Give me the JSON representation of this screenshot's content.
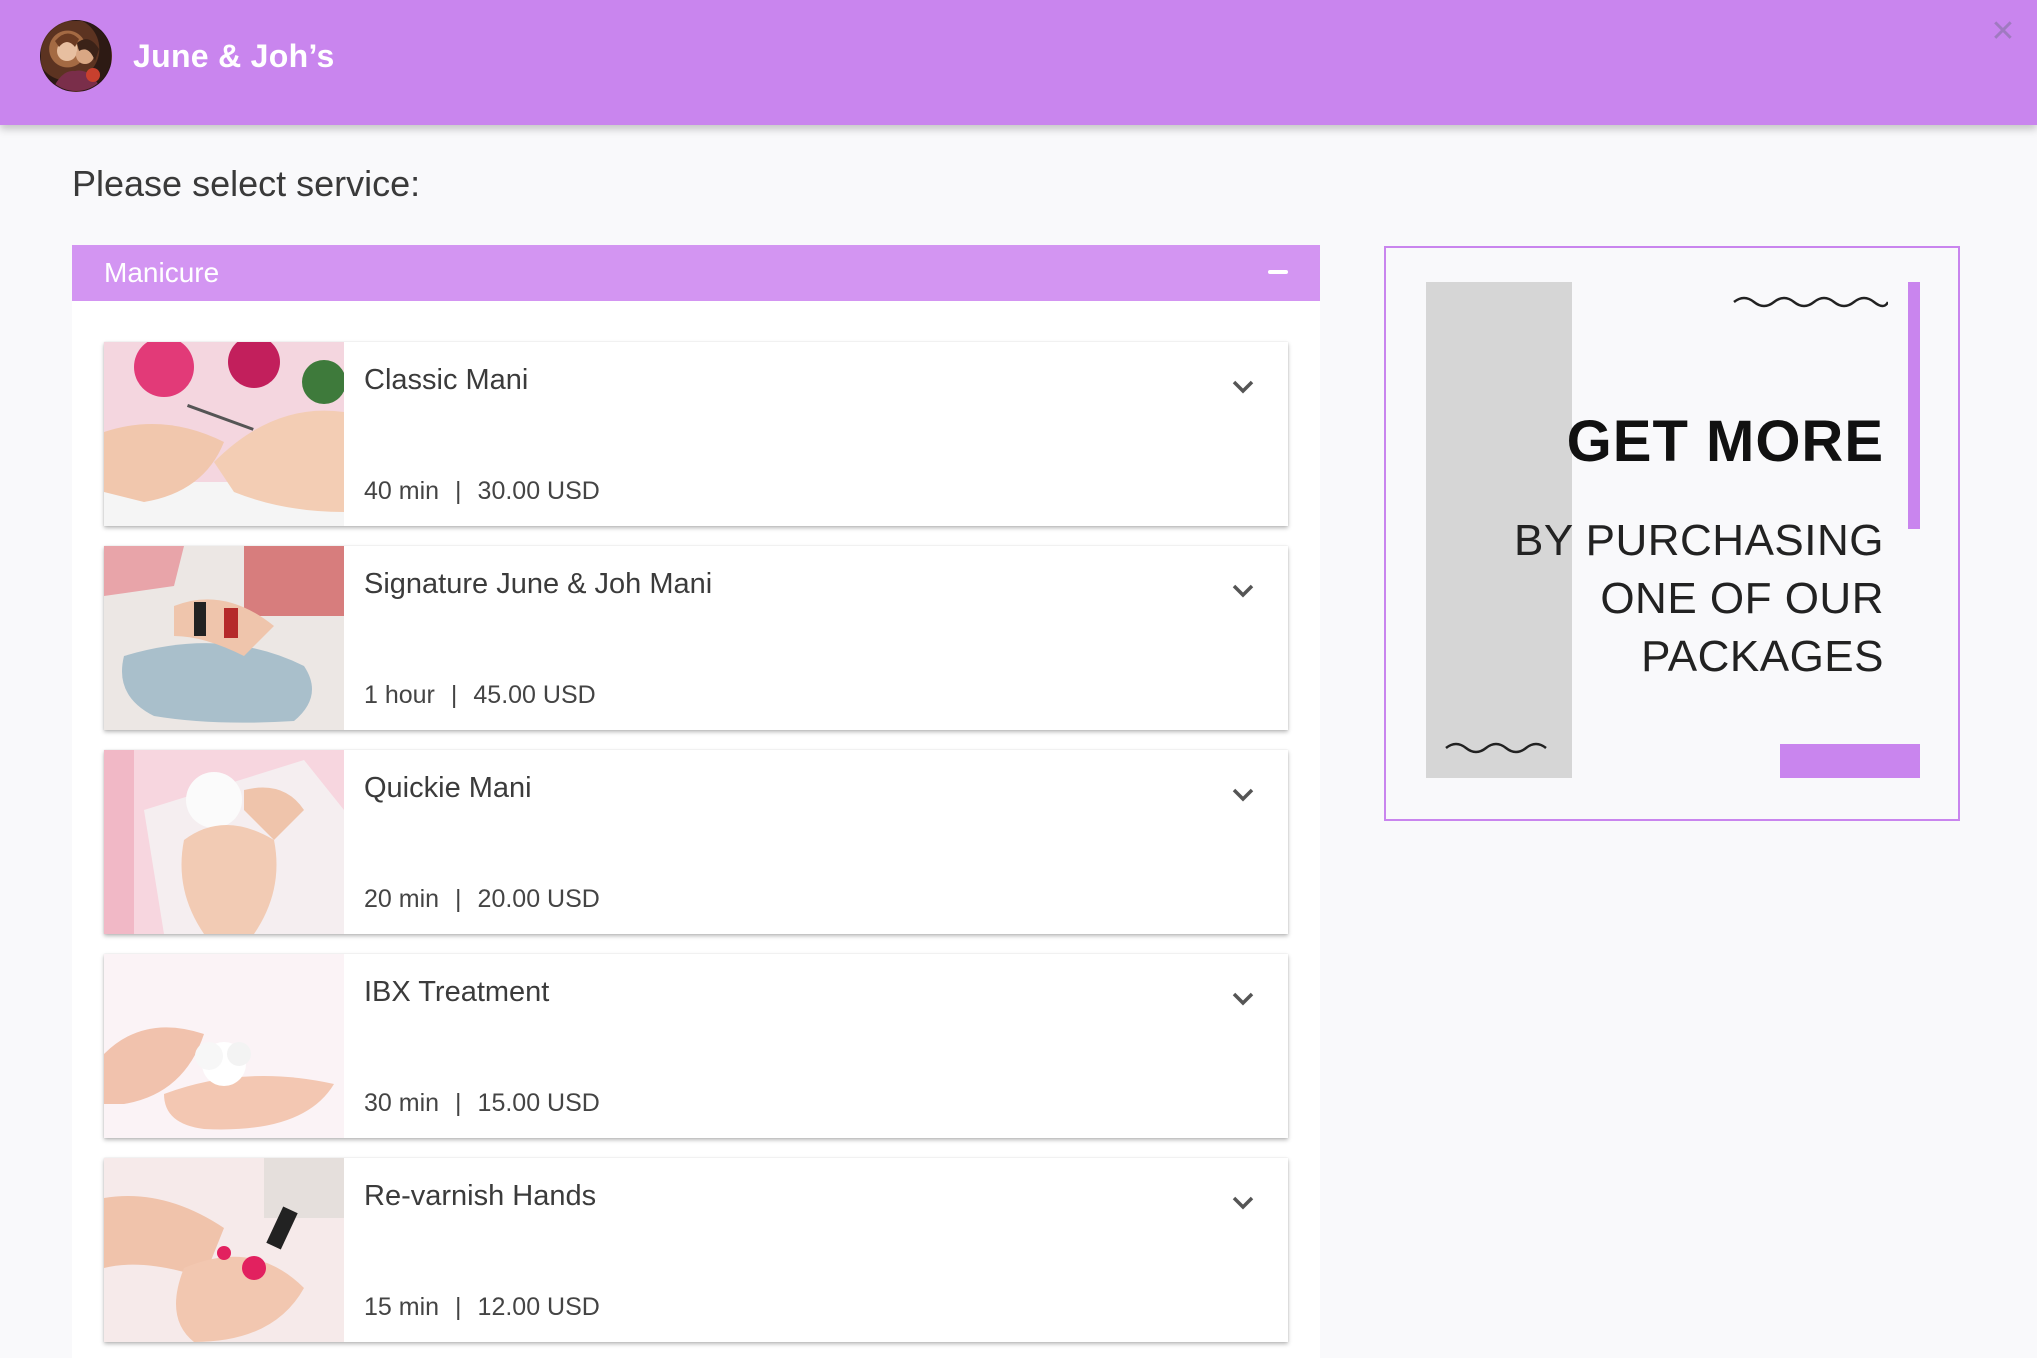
{
  "header": {
    "title": "June & Joh’s",
    "close_label": "✕"
  },
  "page_title": "Please select service:",
  "category": {
    "label": "Manicure"
  },
  "services": [
    {
      "name": "Classic Mani",
      "duration": "40 min",
      "separator": "|",
      "price": "30.00 USD"
    },
    {
      "name": "Signature June & Joh Mani",
      "duration": "1 hour",
      "separator": "|",
      "price": "45.00 USD"
    },
    {
      "name": "Quickie Mani",
      "duration": "20 min",
      "separator": "|",
      "price": "20.00 USD"
    },
    {
      "name": "IBX Treatment",
      "duration": "30 min",
      "separator": "|",
      "price": "15.00 USD"
    },
    {
      "name": "Re-varnish Hands",
      "duration": "15 min",
      "separator": "|",
      "price": "12.00 USD"
    }
  ],
  "promo": {
    "headline": "GET MORE",
    "subtext": "BY PURCHASING ONE OF OUR PACKAGES"
  },
  "colors": {
    "brand": "#c985ee",
    "category_bar": "#d395f2"
  },
  "icons": {
    "collapse": "minus-icon",
    "expand": "chevron-down-icon",
    "close": "close-icon"
  }
}
